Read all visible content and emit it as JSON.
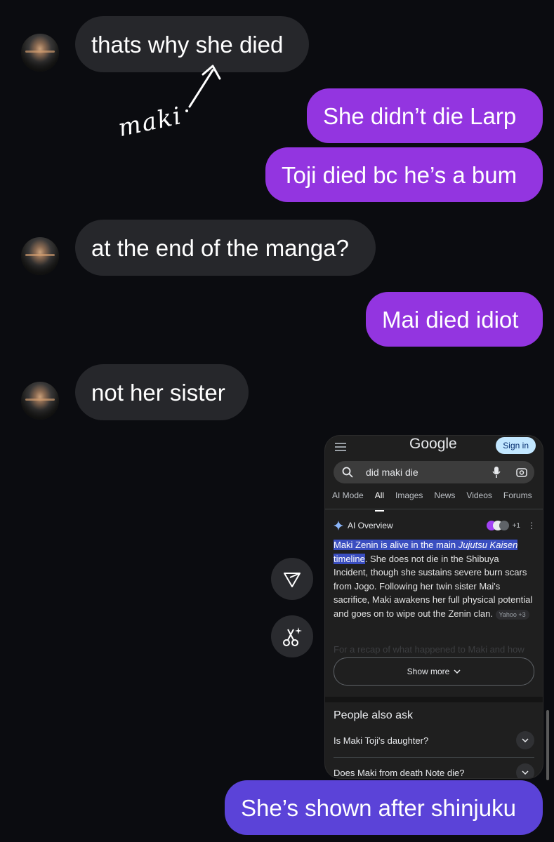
{
  "messages": {
    "m1": "thats why she died",
    "m2": "She didn’t die Larp",
    "m3": "Toji died bc he’s a bum",
    "m4": "at the end of the manga?",
    "m5": "Mai died idiot",
    "m6": "not her sister",
    "m7": "She’s shown after shinjuku"
  },
  "annotation": {
    "text": "maki"
  },
  "icons": {
    "send": "send-icon",
    "edit": "scissors-sparkle-icon"
  },
  "screenshot": {
    "logo": "Google",
    "sign_in": "Sign in",
    "search_value": "did maki die",
    "tabs": [
      "AI Mode",
      "All",
      "Images",
      "News",
      "Videos",
      "Forums"
    ],
    "ai_title": "AI Overview",
    "ai_count": "+1",
    "ai_highlight_1": "Maki Zenin is alive in the main ",
    "ai_highlight_italic": "Jujutsu Kaisen",
    "ai_highlight_2": "timeline",
    "ai_text": ". She does not die in the Shibuya Incident, though she sustains severe burn scars from Jogo. Following her twin sister Mai's sacrifice, Maki awakens her full physical potential and goes on to wipe out the Zenin clan. ",
    "source_chip": "Yahoo +3",
    "ai_faded": "For a recap of what happened to Maki and how",
    "show_more": "Show more",
    "paa_title": "People also ask",
    "paa": [
      "Is Maki Toji's daughter?",
      "Does Maki from death Note die?"
    ]
  },
  "colors": {
    "background": "#0b0c10",
    "incoming": "#26272b",
    "outgoing": "#9335e0",
    "outgoing_last": "#5b43d8"
  }
}
